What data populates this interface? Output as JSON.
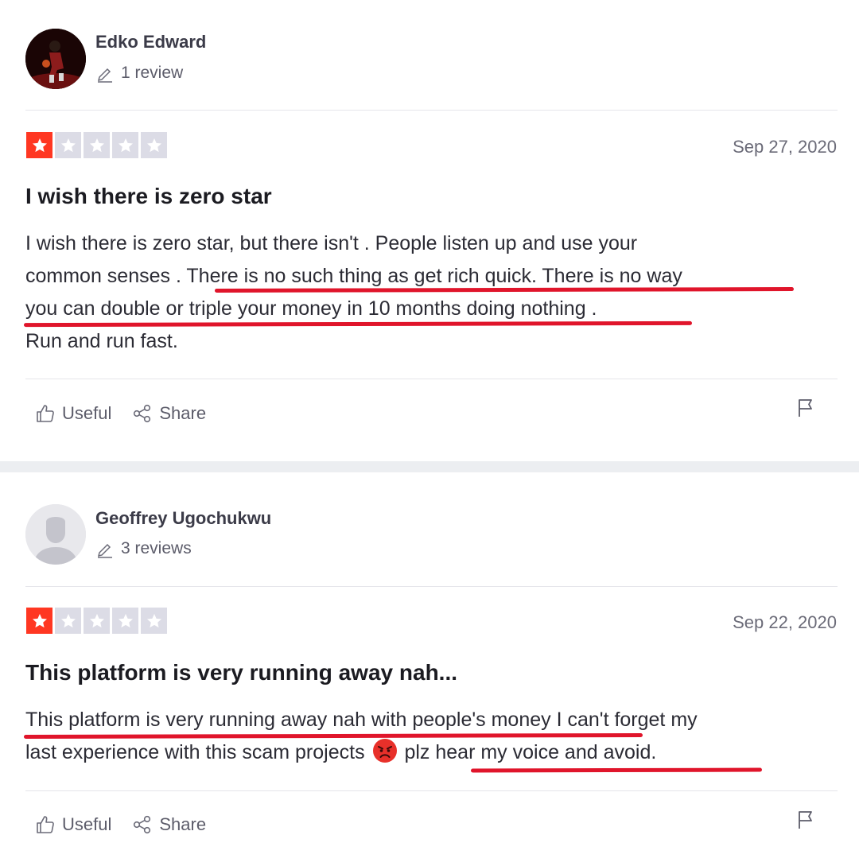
{
  "reviews": [
    {
      "reviewer_name": "Edko Edward",
      "review_count": "1 review",
      "rating": 1,
      "rating_max": 5,
      "date": "Sep 27, 2020",
      "title": "I wish there is zero star",
      "body_lines": [
        "I wish there is zero star, but there isn't . People listen up and use your",
        "common senses . There is no such thing as get rich quick. There is no way",
        "you can double or triple your money in 10 months doing nothing .",
        "Run and run fast."
      ],
      "useful_label": "Useful",
      "share_label": "Share",
      "accent_color": "#ff3722"
    },
    {
      "reviewer_name": "Geoffrey Ugochukwu",
      "review_count": "3 reviews",
      "rating": 1,
      "rating_max": 5,
      "date": "Sep 22, 2020",
      "title": "This platform is very running away nah...",
      "body_lines": [
        "This platform is very running away nah with people's money I can't forget my",
        "last experience with this scam projects",
        "plz hear my voice and avoid."
      ],
      "emoji": "angry-face-icon",
      "useful_label": "Useful",
      "share_label": "Share",
      "accent_color": "#ff3722"
    }
  ],
  "annotation_color": "#e0152b"
}
